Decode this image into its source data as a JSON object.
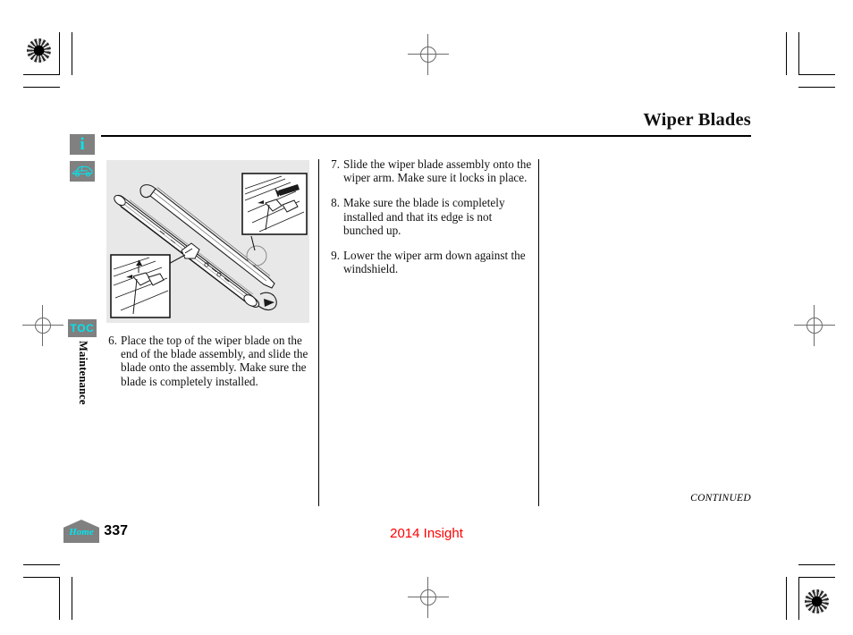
{
  "document": {
    "title": "Wiper Blades",
    "section_label": "Maintenance",
    "model_line": "2014 Insight",
    "page_number": "337",
    "continued_label": "CONTINUED"
  },
  "sidebar": {
    "info_icon_glyph": "i",
    "info_icon_name": "info-icon",
    "vehicle_icon_name": "vehicle-icon",
    "toc_label": "TOC",
    "home_label": "Home",
    "icon_bg_color": "#808080",
    "icon_fg_color": "#00e5ee"
  },
  "figure": {
    "caption": "",
    "alt": "Wiper blade assembly with two magnified callout details showing the blade clip engagement",
    "background_color": "#e8e8e8"
  },
  "steps_left": [
    {
      "number": "6.",
      "text": "Place the top of the wiper blade on the end of the blade assembly, and slide the blade onto the assembly. Make sure the blade is completely installed."
    }
  ],
  "steps_right": [
    {
      "number": "7.",
      "text": "Slide the wiper blade assembly onto the wiper arm. Make sure it locks in place."
    },
    {
      "number": "8.",
      "text": "Make sure the blade is completely installed and that its edge is not bunched up."
    },
    {
      "number": "9.",
      "text": "Lower the wiper arm down against the windshield."
    }
  ],
  "colors": {
    "accent_cyan": "#00e5ee",
    "model_red": "#ff0000",
    "rule_black": "#000000",
    "panel_gray": "#808080"
  }
}
